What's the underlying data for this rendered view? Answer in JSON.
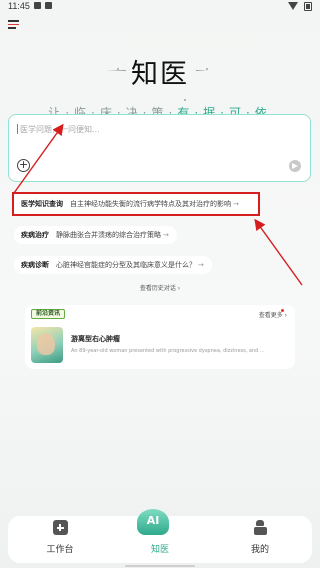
{
  "status_bar": {
    "time": "11:45"
  },
  "brand": {
    "title": "知医",
    "slogan_part1": "让·临·床·决·策·",
    "slogan_part2": "有·据·可·依"
  },
  "input": {
    "placeholder": "医学问题，一问便知...",
    "value": ""
  },
  "suggestions": [
    {
      "tag": "医学知识查询",
      "text": "自主神经功能失衡的流行病学特点及其对治疗的影响",
      "arrow": "→"
    },
    {
      "tag": "疾病治疗",
      "text": "静脉曲张合并溃疡的综合治疗策略",
      "arrow": "→"
    },
    {
      "tag": "疾病诊断",
      "text": "心脏神经官能症的分型及其临床意义是什么？",
      "arrow": "→"
    }
  ],
  "history_link": "查看历史对话 ›",
  "news": {
    "badge": "前沿资讯",
    "more": "查看更多 ›",
    "title": "游离型右心肿瘤",
    "desc": "An 89-year-old woman presented with progressive dyspnea, dizziness, and ..."
  },
  "nav": [
    {
      "label": "工作台",
      "icon": "workbench-icon"
    },
    {
      "label": "知医",
      "icon": "ai-assistant-icon",
      "badge": "AI"
    },
    {
      "label": "我的",
      "icon": "profile-icon"
    }
  ],
  "colors": {
    "accent": "#2fa98c",
    "annotation": "#d61e1e",
    "input_border": "#8fe3d2"
  }
}
